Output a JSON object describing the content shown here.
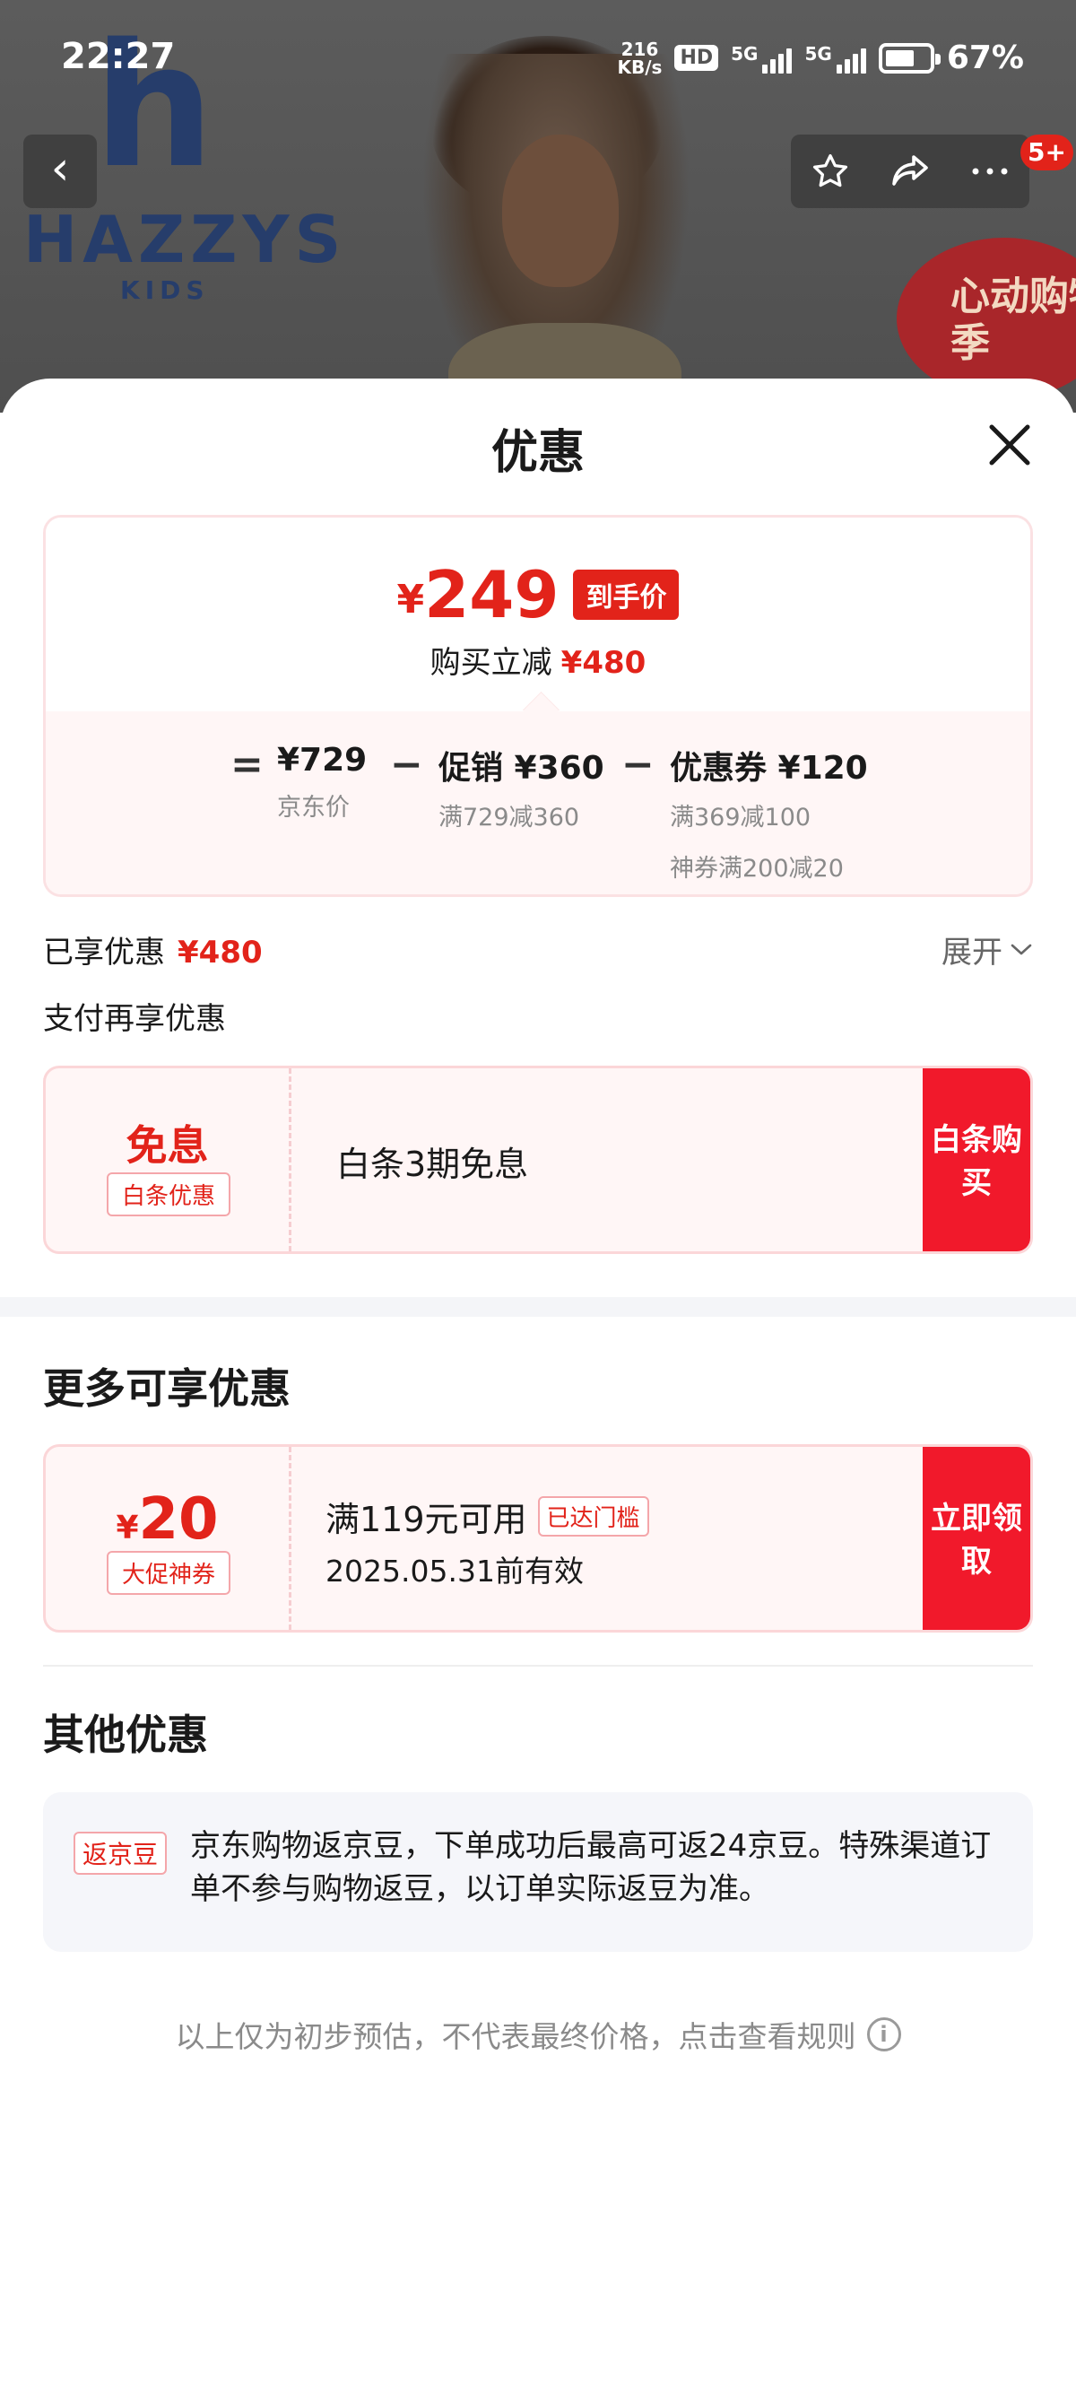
{
  "status_bar": {
    "time": "22:27",
    "net_speed_value": "216",
    "net_speed_unit": "KB/s",
    "hd_label": "HD",
    "signal1_label": "5G",
    "signal2_label": "5G",
    "battery_percent": "67%",
    "battery_level": 0.67
  },
  "product_background": {
    "brand_mark": "h",
    "brand_name": "HAZZYS",
    "brand_sub": "KIDS",
    "promo_badge": "心动购物季"
  },
  "nav": {
    "back_icon": "chevron-left-icon",
    "favorite_icon": "star-icon",
    "share_icon": "share-icon",
    "more_icon": "more-icon",
    "message_count": "5+"
  },
  "sheet": {
    "title": "优惠",
    "close_icon": "close-icon",
    "price_summary": {
      "currency": "¥",
      "final_price": "249",
      "final_tag": "到手价",
      "save_label": "购买立减",
      "save_amount": "¥480",
      "equals": "=",
      "minus": "−",
      "jd_price": "¥729",
      "jd_price_label": "京东价",
      "promo_price": "促销 ¥360",
      "promo_detail": "满729减360",
      "coupon_price": "优惠券 ¥120",
      "coupon_detail_1": "满369减100",
      "coupon_detail_2": "神券满200减20"
    },
    "enjoyed": {
      "label": "已享优惠",
      "amount": "¥480",
      "expand_label": "展开"
    },
    "pay_more_title": "支付再享优惠",
    "baitiao_card": {
      "big_text": "免息",
      "tag": "白条优惠",
      "description": "白条3期免息",
      "button": "白条购买"
    },
    "more_section_title": "更多可享优惠",
    "coupon_card": {
      "currency": "¥",
      "amount": "20",
      "tag": "大促神券",
      "condition": "满119元可用",
      "threshold_tag": "已达门槛",
      "validity": "2025.05.31前有效",
      "button": "立即领取"
    },
    "other_section_title": "其他优惠",
    "other_offer": {
      "tag": "返京豆",
      "text": "京东购物返京豆，下单成功后最高可返24京豆。特殊渠道订单不参与购物返豆，以订单实际返豆为准。"
    },
    "disclaimer": "以上仅为初步预估，不代表最终价格，点击查看规则",
    "info_icon": "info-icon"
  },
  "colors": {
    "accent_red": "#e2231a",
    "button_red": "#f1192b",
    "brand_navy": "#263d6b"
  }
}
